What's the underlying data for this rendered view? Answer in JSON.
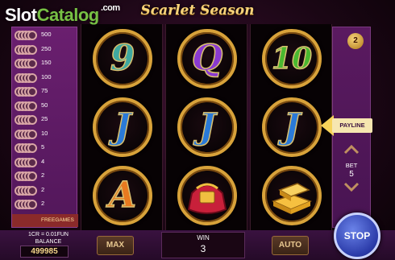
{
  "watermark": {
    "part1": "Slot",
    "part2": "Catalog",
    "part3": ".com"
  },
  "game": {
    "title": "Scarlet Season"
  },
  "paytable": {
    "rows": [
      {
        "value": "500"
      },
      {
        "value": "250"
      },
      {
        "value": "150"
      },
      {
        "value": "100"
      },
      {
        "value": "75"
      },
      {
        "value": "50"
      },
      {
        "value": "25"
      },
      {
        "value": "10"
      },
      {
        "value": "5"
      },
      {
        "value": "4"
      },
      {
        "value": "2"
      },
      {
        "value": "2"
      },
      {
        "value": "2"
      }
    ],
    "free_label": "FREEGAMES"
  },
  "reels": [
    [
      {
        "glyph": "9",
        "color": "#3fa8a0"
      },
      {
        "glyph": "J",
        "color": "#2a7ad8"
      },
      {
        "glyph": "A",
        "color": "#e87a20"
      }
    ],
    [
      {
        "glyph": "Q",
        "color": "#8a3ad0"
      },
      {
        "glyph": "J",
        "color": "#2a7ad8"
      },
      {
        "glyph": "",
        "color": "#c8203a",
        "icon": "red-bag-icon"
      }
    ],
    [
      {
        "glyph": "10",
        "color": "#4ab830"
      },
      {
        "glyph": "J",
        "color": "#2a7ad8"
      },
      {
        "glyph": "",
        "color": "#e8a820",
        "icon": "gold-bars-icon"
      }
    ]
  ],
  "right_panel": {
    "lines_value": "2",
    "payline_label": "PAYLINE",
    "bet_label": "BET",
    "bet_value": "5"
  },
  "bottom": {
    "cr_rate": "1CR = 0.01FUN",
    "balance_label": "BALANCE",
    "balance_value": "499985",
    "max_label": "MAX",
    "win_label": "WIN",
    "win_value": "3",
    "auto_label": "AUTO",
    "stop_label": "STOP"
  }
}
